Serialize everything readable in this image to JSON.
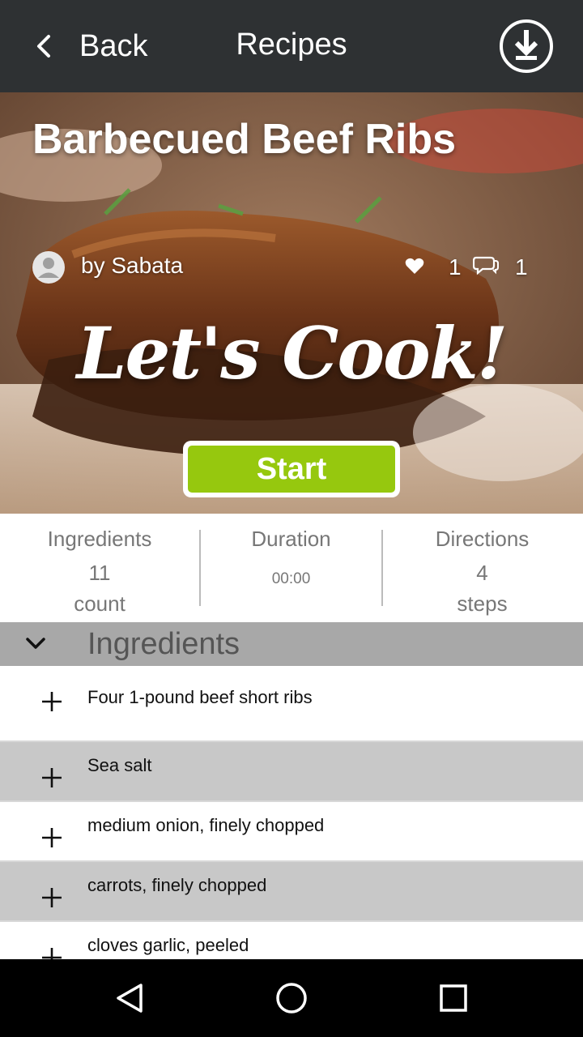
{
  "app_bar": {
    "back_label": "Back",
    "title": "Recipes",
    "icons": {
      "back": "chevron-left-icon",
      "download": "download-icon"
    }
  },
  "recipe": {
    "title": "Barbecued Beef Ribs",
    "author": "by Sabata",
    "likes": "1",
    "comments": "1",
    "tagline": "Let's Cook!",
    "start_label": "Start"
  },
  "stats": {
    "ingredients": {
      "label": "Ingredients",
      "value": "11",
      "unit": "count"
    },
    "duration": {
      "label": "Duration",
      "value": "00:00"
    },
    "directions": {
      "label": "Directions",
      "value": "4",
      "unit": "steps"
    }
  },
  "section": {
    "title": "Ingredients"
  },
  "ingredients": [
    "Four 1-pound beef short ribs",
    "Sea salt",
    "medium onion, finely chopped",
    "carrots, finely chopped",
    "cloves garlic, peeled"
  ],
  "colors": {
    "app_bar": "#2e3133",
    "start_button": "#96c80e",
    "section_header": "#a8a8a8",
    "alt_row": "#c8c8c8",
    "nav_bar": "#000000"
  }
}
